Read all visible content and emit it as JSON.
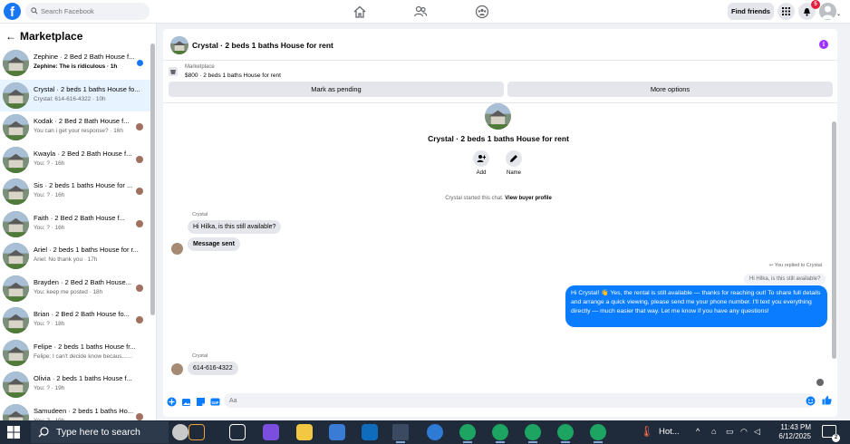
{
  "topbar": {
    "logo": "f",
    "search_placeholder": "Search Facebook",
    "find_friends": "Find friends",
    "notif_count": "5"
  },
  "sidebar": {
    "title": "Marketplace",
    "items": [
      {
        "title": "Zephine · 2 Bed 2 Bath House f...",
        "sub": "Zephine: The is ridiculous · 1h",
        "bold": true,
        "active": false,
        "marker": "dot"
      },
      {
        "title": "Crystal · 2 beds 1 baths House fo...",
        "sub": "Crystal: 614-616-4322 · 10h",
        "bold": false,
        "active": true,
        "marker": "none"
      },
      {
        "title": "Kodak · 2 Bed 2 Bath House f...",
        "sub": "You can i get your response? · 16h",
        "bold": false,
        "active": false,
        "marker": "avatar"
      },
      {
        "title": "Kwayla · 2 Bed 2 Bath House f...",
        "sub": "You: ? · 16h",
        "bold": false,
        "active": false,
        "marker": "avatar"
      },
      {
        "title": "Sis · 2 beds 1 baths House for ...",
        "sub": "You: ? · 16h",
        "bold": false,
        "active": false,
        "marker": "avatar"
      },
      {
        "title": "Faith · 2 Bed 2 Bath House f...",
        "sub": "You: ? · 16h",
        "bold": false,
        "active": false,
        "marker": "avatar"
      },
      {
        "title": "Ariel · 2 beds 1 baths House for r...",
        "sub": "Ariel: No thank you · 17h",
        "bold": false,
        "active": false,
        "marker": "none"
      },
      {
        "title": "Brayden · 2 Bed 2 Bath House...",
        "sub": "You: keep me posted · 18h",
        "bold": false,
        "active": false,
        "marker": "avatar"
      },
      {
        "title": "Brian · 2 Bed 2 Bath House fo...",
        "sub": "You: ? · 18h",
        "bold": false,
        "active": false,
        "marker": "avatar"
      },
      {
        "title": "Felipe · 2 beds 1 baths House fr...",
        "sub": "Felipe: I can't decide know becaus... · 19h",
        "bold": false,
        "active": false,
        "marker": "none"
      },
      {
        "title": "Olivia · 2 beds 1 baths House f...",
        "sub": "You: ? · 19h",
        "bold": false,
        "active": false,
        "marker": "none"
      },
      {
        "title": "Samudeen · 2 beds 1 baths Ho...",
        "sub": "You: ? · 19h",
        "bold": false,
        "active": false,
        "marker": "avatar"
      }
    ]
  },
  "chat": {
    "header_title": "Crystal · 2 beds 1 baths House for rent",
    "marketplace_label": "Marketplace",
    "listing_line": "$800 · 2 beds 1 baths House for rent",
    "mark_pending": "Mark as pending",
    "more_options": "More options",
    "center_title": "Crystal · 2 beds 1 baths House for rent",
    "action_add": "Add",
    "action_name": "Name",
    "started_prefix": "Crystal started this chat. ",
    "started_link": "View buyer profile",
    "sender_name": "Crystal",
    "msg_in_1": "Hi Hilka, is this still available?",
    "msg_in_2": "Message sent",
    "replied_label": "You replied to Crystal",
    "quote_text": "Hi Hilka, is this still available?",
    "msg_out": "Hi Crystal! 👋 Yes, the rental is still available — thanks for reaching out! To share full details and arrange a quick viewing, please send me your phone number. I'll text you everything directly — much easier that way. Let me know if you have any questions!",
    "sender_name_2": "Crystal",
    "msg_in_3": "614-616-4322",
    "composer_placeholder": "Aa"
  },
  "taskbar": {
    "search_text": "Type here to search",
    "weather": "Hot...",
    "time": "11:43 PM",
    "date": "6/12/2025",
    "notif_count": "2"
  },
  "colors": {
    "brand": "#1877f2",
    "outgoing_bubble": "#0a7cff",
    "taskbar": "#1f2a3a"
  }
}
